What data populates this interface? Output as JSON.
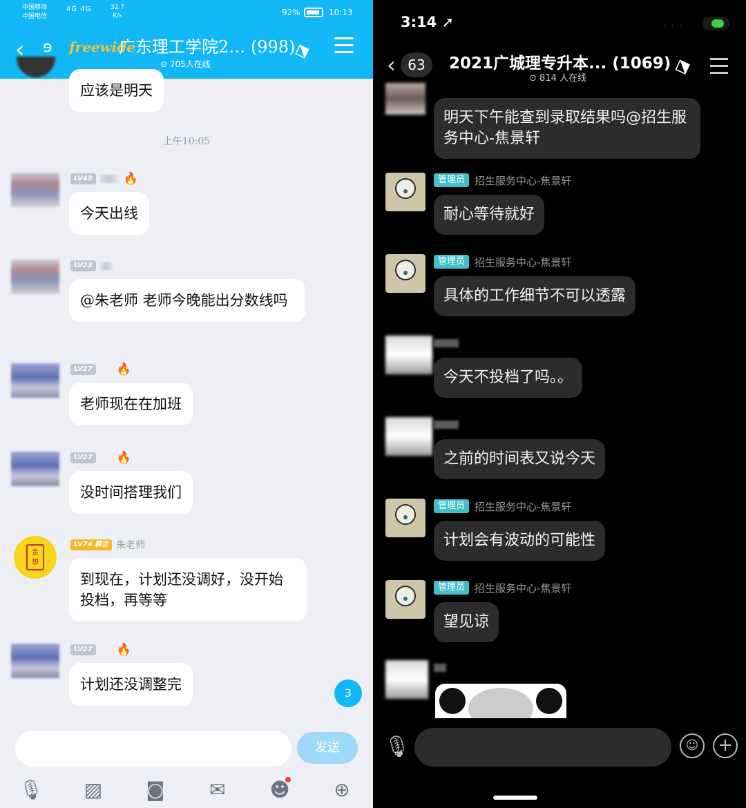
{
  "left": {
    "status": {
      "carrier1": "中国移动",
      "carrier2": "中国电信",
      "network": "4G 4G",
      "speed": "32.7",
      "speed_unit": "K/s",
      "battery": "92%",
      "time": "10:13"
    },
    "header": {
      "back_icon": "back-arrow-icon",
      "brand": "freewide",
      "title": "广东理工学院2…",
      "count": "(998)",
      "online": "705人在线"
    },
    "chat": {
      "top_message": "应该是明天",
      "timestamp": "上午10:05",
      "messages": [
        {
          "level": "LV43",
          "text": "今天出线"
        },
        {
          "level": "LV23",
          "text": "@朱老师 老师今晚能出分数线吗"
        },
        {
          "level": "LV27",
          "text": "老师现在在加班"
        },
        {
          "level": "LV27",
          "text": "没时间搭理我们"
        },
        {
          "level": "LV74 群主",
          "name": "朱老师",
          "text": "到现在，计划还没调好，没开始投档，再等等"
        },
        {
          "level": "LV27",
          "text": "计划还没调整完"
        }
      ],
      "unread": "3"
    },
    "input": {
      "send": "发送"
    }
  },
  "right": {
    "status": {
      "time": "3:14"
    },
    "header": {
      "badge": "63",
      "title": "2021广城理专升本...",
      "count": "(1069)",
      "online": "814 人在线"
    },
    "chat": {
      "messages": [
        {
          "text": "明天下午能查到录取结果吗@招生服务中心-焦景轩"
        },
        {
          "role": "管理员",
          "name": "招生服务中心-焦景轩",
          "text": "耐心等待就好"
        },
        {
          "role": "管理员",
          "name": "招生服务中心-焦景轩",
          "text": "具体的工作细节不可以透露"
        },
        {
          "text": "今天不投档了吗。。"
        },
        {
          "text": "之前的时间表又说今天"
        },
        {
          "role": "管理员",
          "name": "招生服务中心-焦景轩",
          "text": "计划会有波动的可能性"
        },
        {
          "role": "管理员",
          "name": "招生服务中心-焦景轩",
          "text": "望见谅"
        }
      ]
    }
  },
  "colors": {
    "qq_blue": "#12b7f5",
    "admin_tag": "#3fc1c9",
    "flame": "#f05a1a",
    "owner_level": "#f5b924"
  }
}
